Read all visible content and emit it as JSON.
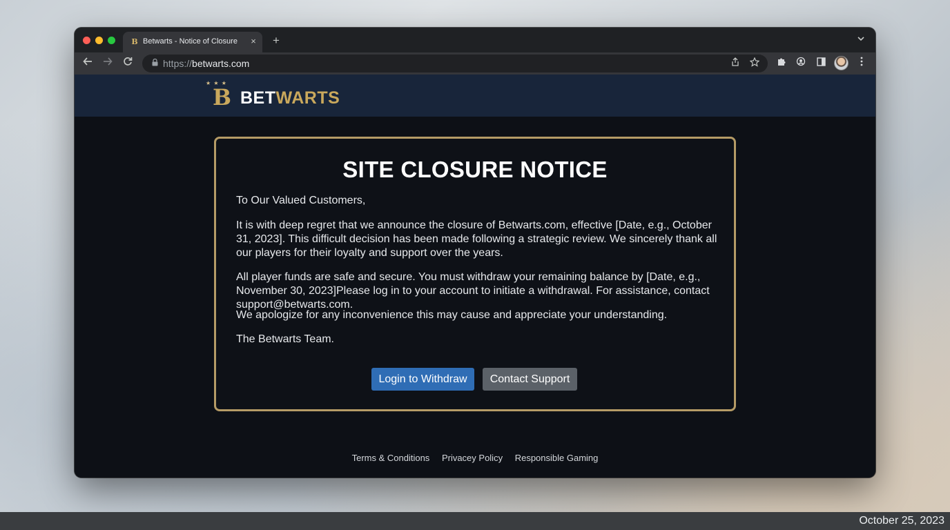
{
  "browser": {
    "tab_favicon": "B",
    "tab_title": "Betwarts - Notice of Closure",
    "tab_close": "×",
    "new_tab": "+",
    "tab_menu": "⌄",
    "url_scheme": "https://",
    "url_host": "betwarts.com",
    "icons": {
      "back": "back-arrow-icon",
      "forward": "forward-arrow-icon",
      "reload": "reload-icon",
      "lock": "lock-icon",
      "share": "share-icon",
      "bookmark": "star-icon",
      "extensions": "puzzle-icon",
      "extension2": "extension-icon",
      "side_panel": "side-panel-icon",
      "profile": "avatar",
      "menu": "kebab-menu-icon"
    }
  },
  "site": {
    "logo_letter": "B",
    "logo_stars": "★ ★ ★",
    "logo_bet": "BET",
    "logo_warts": "WARTS",
    "colors": {
      "header_bg": "#18253a",
      "gold": "#c9a85c",
      "primary_button": "#2f6db5",
      "secondary_button": "#5b6168"
    }
  },
  "notice": {
    "title": "SITE CLOSURE NOTICE",
    "greeting": "To Our Valued Customers,",
    "paragraph1": "It is with deep regret that we announce the closure of Betwarts.com, effective [Date, e.g., October 31, 2023]. This difficult decision has been made following a strategic review. We sincerely thank all our players for their loyalty and support over the years.",
    "paragraph2": "All player funds are safe and secure. You must withdraw your remaining balance by [Date, e.g., November 30, 2023]Please log in to your account to initiate a withdrawal. For assistance, contact support@betwarts.com.",
    "paragraph3": "We apologize for any inconvenience this may cause and appreciate your understanding.",
    "signoff": "The Betwarts Team.",
    "login_button": "Login to Withdraw",
    "support_button": "Contact Support"
  },
  "footer": {
    "terms": "Terms & Conditions",
    "privacy": "Privacey Policy",
    "responsible": "Responsible Gaming"
  },
  "taskbar": {
    "date": "October 25, 2023"
  }
}
